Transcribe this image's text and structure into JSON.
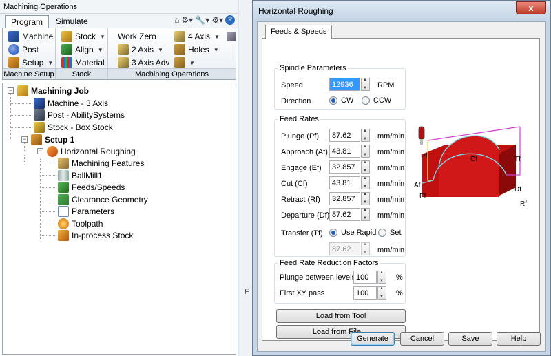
{
  "left_panel": {
    "title": "Machining Operations",
    "tabs": [
      {
        "label": "Program",
        "active": true
      },
      {
        "label": "Simulate",
        "active": false
      }
    ],
    "toolbar_icons": [
      "home-icon",
      "gear-dropdown-icon",
      "wrench-icon",
      "settings-icon",
      "help-icon"
    ],
    "help_glyph": "?",
    "ribbon": {
      "machine_setup": {
        "label": "Machine Setup",
        "buttons": [
          {
            "label": "Machine"
          },
          {
            "label": "Post"
          },
          {
            "label": "Setup"
          }
        ]
      },
      "stock": {
        "label": "Stock",
        "buttons": [
          {
            "label": "Stock"
          },
          {
            "label": "Align"
          },
          {
            "label": "Material"
          }
        ]
      },
      "machining_operations": {
        "label": "Machining Operations",
        "buttons": [
          {
            "label": "Work Zero"
          },
          {
            "label": "4 Axis"
          },
          {
            "label": "2 Axis"
          },
          {
            "label": "Holes"
          },
          {
            "label": "3 Axis Adv"
          }
        ]
      }
    },
    "tree": [
      {
        "label": "Machining Job",
        "bold": true
      },
      {
        "label": "Machine - 3 Axis"
      },
      {
        "label": "Post - AbilitySystems"
      },
      {
        "label": "Stock - Box Stock"
      },
      {
        "label": "Setup 1",
        "bold": true
      },
      {
        "label": "Horizontal Roughing"
      },
      {
        "label": "Machining Features"
      },
      {
        "label": "BallMill1"
      },
      {
        "label": "Feeds/Speeds"
      },
      {
        "label": "Clearance Geometry"
      },
      {
        "label": "Parameters"
      },
      {
        "label": "Toolpath"
      },
      {
        "label": "In-process Stock"
      }
    ]
  },
  "center_label": "F",
  "dialog": {
    "title": "Horizontal Roughing",
    "close_glyph": "x",
    "tab": "Feeds & Speeds",
    "spindle": {
      "group_label": "Spindle Parameters",
      "speed_label": "Speed",
      "speed_value": "12936",
      "speed_unit": "RPM",
      "direction_label": "Direction",
      "cw_label": "CW",
      "ccw_label": "CCW",
      "direction": "CW"
    },
    "feed_rates": {
      "group_label": "Feed Rates",
      "rows": [
        {
          "label": "Plunge (Pf)",
          "value": "87.62",
          "unit": "mm/min"
        },
        {
          "label": "Approach (Af)",
          "value": "43.81",
          "unit": "mm/min"
        },
        {
          "label": "Engage (Ef)",
          "value": "32.857",
          "unit": "mm/min"
        },
        {
          "label": "Cut (Cf)",
          "value": "43.81",
          "unit": "mm/min"
        },
        {
          "label": "Retract (Rf)",
          "value": "32.857",
          "unit": "mm/min"
        },
        {
          "label": "Departure (Df)",
          "value": "87.62",
          "unit": "mm/min"
        }
      ],
      "transfer_label": "Transfer (Tf)",
      "use_rapid_label": "Use Rapid",
      "set_label": "Set",
      "transfer_mode": "Use Rapid",
      "transfer_value": "87.62",
      "transfer_unit": "mm/min"
    },
    "reduction": {
      "group_label": "Feed Rate Reduction Factors",
      "rows": [
        {
          "label": "Plunge between levels",
          "value": "100",
          "unit": "%"
        },
        {
          "label": "First XY pass",
          "value": "100",
          "unit": "%"
        }
      ]
    },
    "load_from_tool": "Load from Tool",
    "load_from_file": "Load from File ...",
    "preview_labels": {
      "pf": "Pf",
      "cf": "Cf",
      "tf": "Tf",
      "af": "Af",
      "df": "Df",
      "ef": "Ef",
      "rf": "Rf"
    },
    "buttons": {
      "generate": "Generate",
      "cancel": "Cancel",
      "save": "Save",
      "help": "Help"
    },
    "colors": {
      "stock_red": "#cc1111",
      "toolpath_cyan": "#7ad3e0",
      "toolpath_yellow": "#f0e040",
      "toolpath_magenta": "#d040d0"
    }
  }
}
